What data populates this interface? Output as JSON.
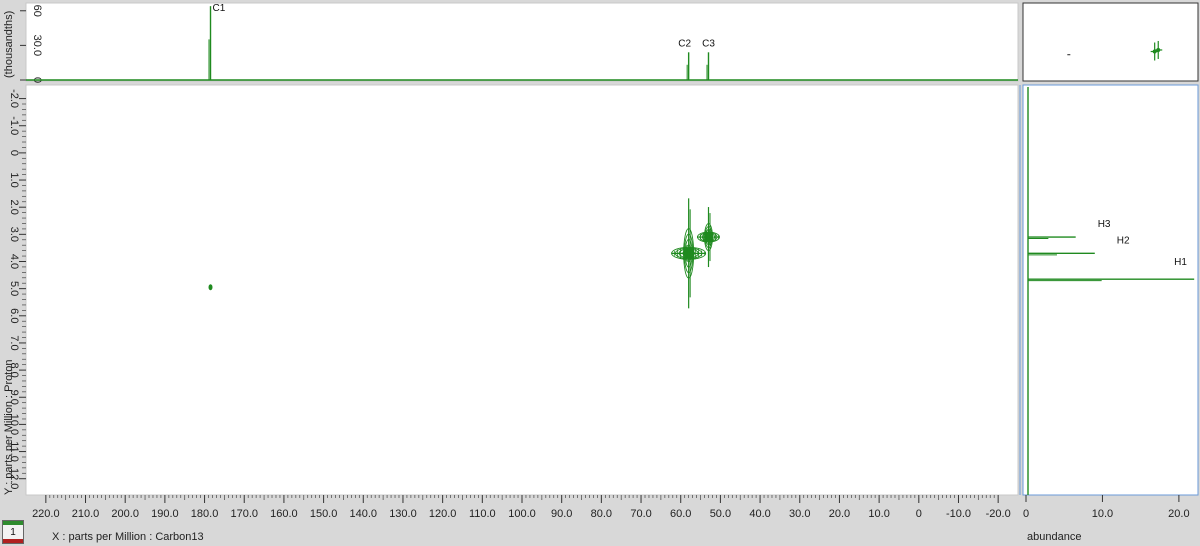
{
  "colors": {
    "peak": "#1f8a1f",
    "frame": "#6a9ad8",
    "panel_bg": "#ffffff",
    "background": "#d8d8d8"
  },
  "page_tab": {
    "number": "1"
  },
  "chart_data": {
    "type": "heatmap",
    "kind": "2D NMR correlation contour plot with 1D projections",
    "xlabel": "X : parts per Million : Carbon13",
    "ylabel": "Y : parts per Million : Proton",
    "xlim": [
      225.0,
      -25.0
    ],
    "ylim": [
      -2.5,
      12.6
    ],
    "x_ticks": [
      "220.0",
      "210.0",
      "200.0",
      "190.0",
      "180.0",
      "170.0",
      "160.0",
      "150.0",
      "140.0",
      "130.0",
      "120.0",
      "110.0",
      "100.0",
      "90.0",
      "80.0",
      "70.0",
      "60.0",
      "50.0",
      "40.0",
      "30.0",
      "20.0",
      "10.0",
      "0",
      "-10.0",
      "-20.0"
    ],
    "y_ticks": [
      "-2.0",
      "-1.0",
      "0",
      "1.0",
      "2.0",
      "3.0",
      "4.0",
      "5.0",
      "6.0",
      "7.0",
      "8.0",
      "9.0",
      "10.0",
      "11.0",
      "12.0"
    ],
    "cross_peaks": [
      {
        "x": 178.5,
        "y": 4.95,
        "size": "small"
      },
      {
        "x": 58.0,
        "y": 3.7,
        "size": "large"
      },
      {
        "x": 53.0,
        "y": 3.1,
        "size": "medium"
      }
    ],
    "top_projection": {
      "ylabel": "(thousandths)",
      "ylim": [
        0,
        65
      ],
      "ticks": [
        "0",
        "30.0",
        "60"
      ],
      "peaks": [
        {
          "x": 178.5,
          "height": 64,
          "label": "C1"
        },
        {
          "x": 58.0,
          "height": 24,
          "label": "C2"
        },
        {
          "x": 53.0,
          "height": 24,
          "label": "C3"
        }
      ]
    },
    "side_projection": {
      "xlabel": "abundance",
      "xlim": [
        0,
        22.5
      ],
      "ticks": [
        "0",
        "10.0",
        "20.0"
      ],
      "peaks": [
        {
          "y": 3.1,
          "value": 6.5,
          "label": "H3"
        },
        {
          "y": 3.7,
          "value": 9.0,
          "label": "H2"
        },
        {
          "y": 4.65,
          "value": 22.0,
          "label": "H1"
        }
      ]
    }
  }
}
